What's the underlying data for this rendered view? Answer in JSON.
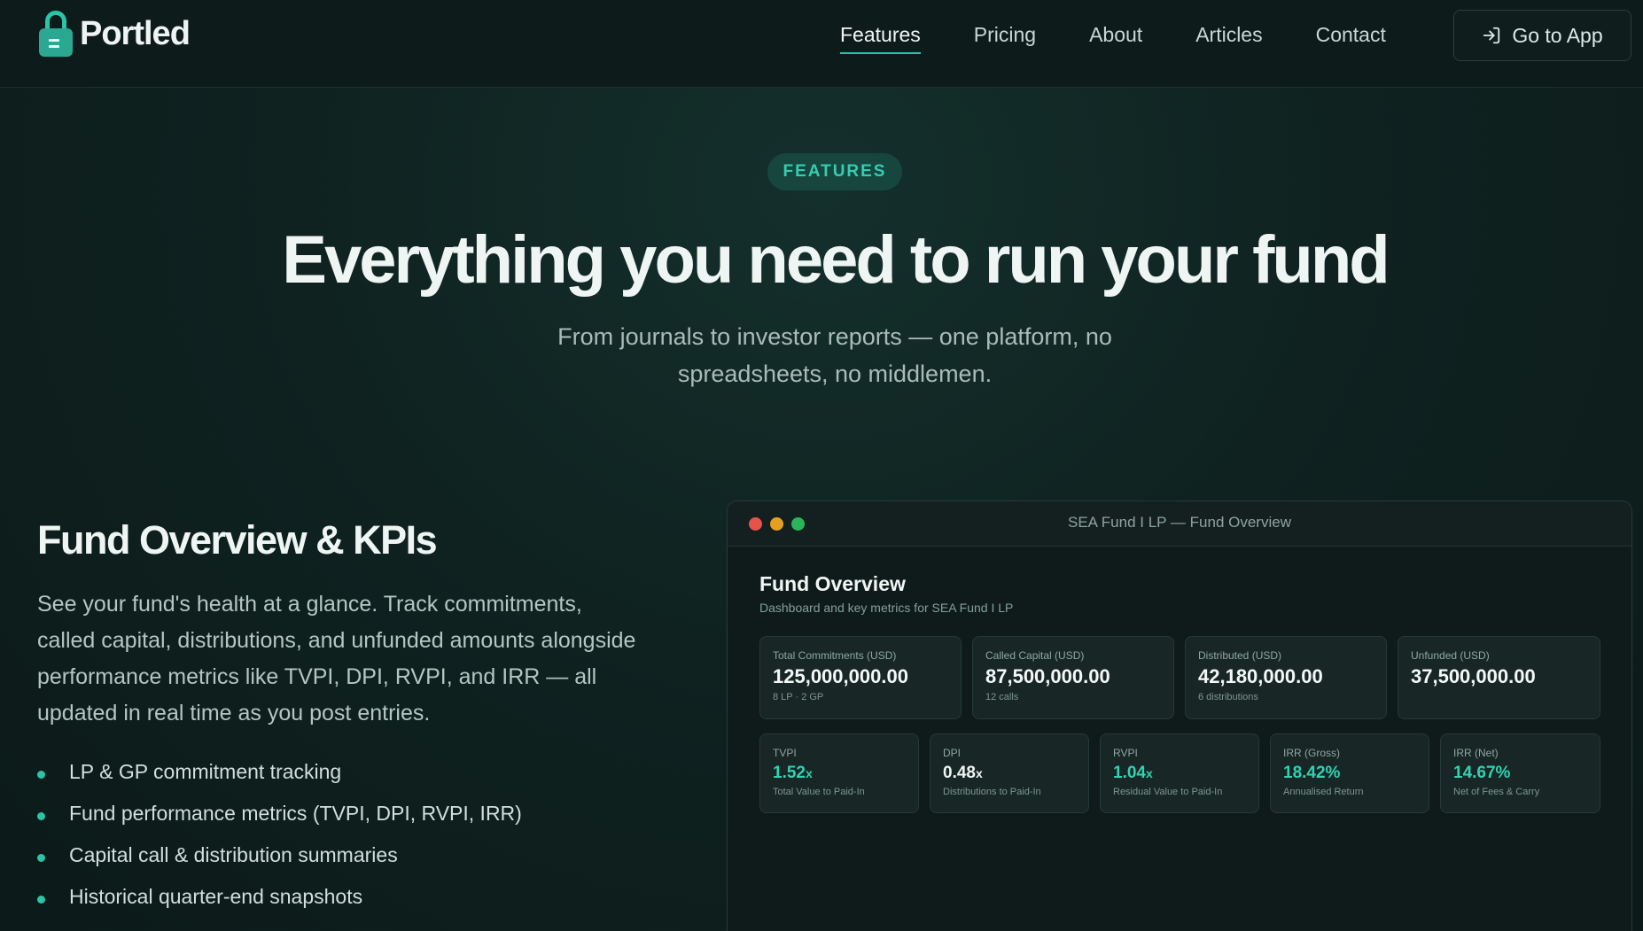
{
  "nav": {
    "brand": "Portled",
    "links": [
      {
        "label": "Features",
        "active": true
      },
      {
        "label": "Pricing",
        "active": false
      },
      {
        "label": "About",
        "active": false
      },
      {
        "label": "Articles",
        "active": false
      },
      {
        "label": "Contact",
        "active": false
      }
    ],
    "cta": "Go to App"
  },
  "hero": {
    "pill": "FEATURES",
    "title": "Everything you need to run your fund",
    "subtitle": "From journals to investor reports — one platform, no spreadsheets, no middlemen."
  },
  "feature": {
    "title": "Fund Overview & KPIs",
    "description": "See your fund's health at a glance. Track commitments, called capital, distributions, and unfunded amounts alongside performance metrics like TVPI, DPI, RVPI, and IRR — all updated in real time as you post entries.",
    "bullets": [
      "LP & GP commitment tracking",
      "Fund performance metrics (TVPI, DPI, RVPI, IRR)",
      "Capital call & distribution summaries",
      "Historical quarter-end snapshots"
    ]
  },
  "window": {
    "title": "SEA Fund I LP — Fund Overview",
    "app_title": "Fund Overview",
    "app_subtitle": "Dashboard and key metrics for SEA Fund I LP",
    "summary_cards": [
      {
        "label": "Total Commitments (USD)",
        "value": "125,000,000.00",
        "note": "8 LP · 2 GP"
      },
      {
        "label": "Called Capital (USD)",
        "value": "87,500,000.00",
        "note": "12 calls"
      },
      {
        "label": "Distributed (USD)",
        "value": "42,180,000.00",
        "note": "6 distributions"
      },
      {
        "label": "Unfunded (USD)",
        "value": "37,500,000.00",
        "note": ""
      }
    ],
    "kpi_cards": [
      {
        "label": "TVPI",
        "value": "1.52",
        "suffix": "x",
        "note": "Total Value to Paid-In",
        "accent": true
      },
      {
        "label": "DPI",
        "value": "0.48",
        "suffix": "x",
        "note": "Distributions to Paid-In",
        "accent": false
      },
      {
        "label": "RVPI",
        "value": "1.04",
        "suffix": "x",
        "note": "Residual Value to Paid-In",
        "accent": true
      },
      {
        "label": "IRR (Gross)",
        "value": "18.42%",
        "suffix": "",
        "note": "Annualised Return",
        "accent": true
      },
      {
        "label": "IRR (Net)",
        "value": "14.67%",
        "suffix": "",
        "note": "Net of Fees & Carry",
        "accent": true
      }
    ]
  },
  "colors": {
    "accent": "#2cc4a7",
    "background": "#0f2220",
    "traffic_red": "#e5534b",
    "traffic_yellow": "#e5a021",
    "traffic_green": "#2bb55a"
  },
  "icons": {
    "logo": "lock-icon",
    "cta": "sign-in-icon"
  }
}
